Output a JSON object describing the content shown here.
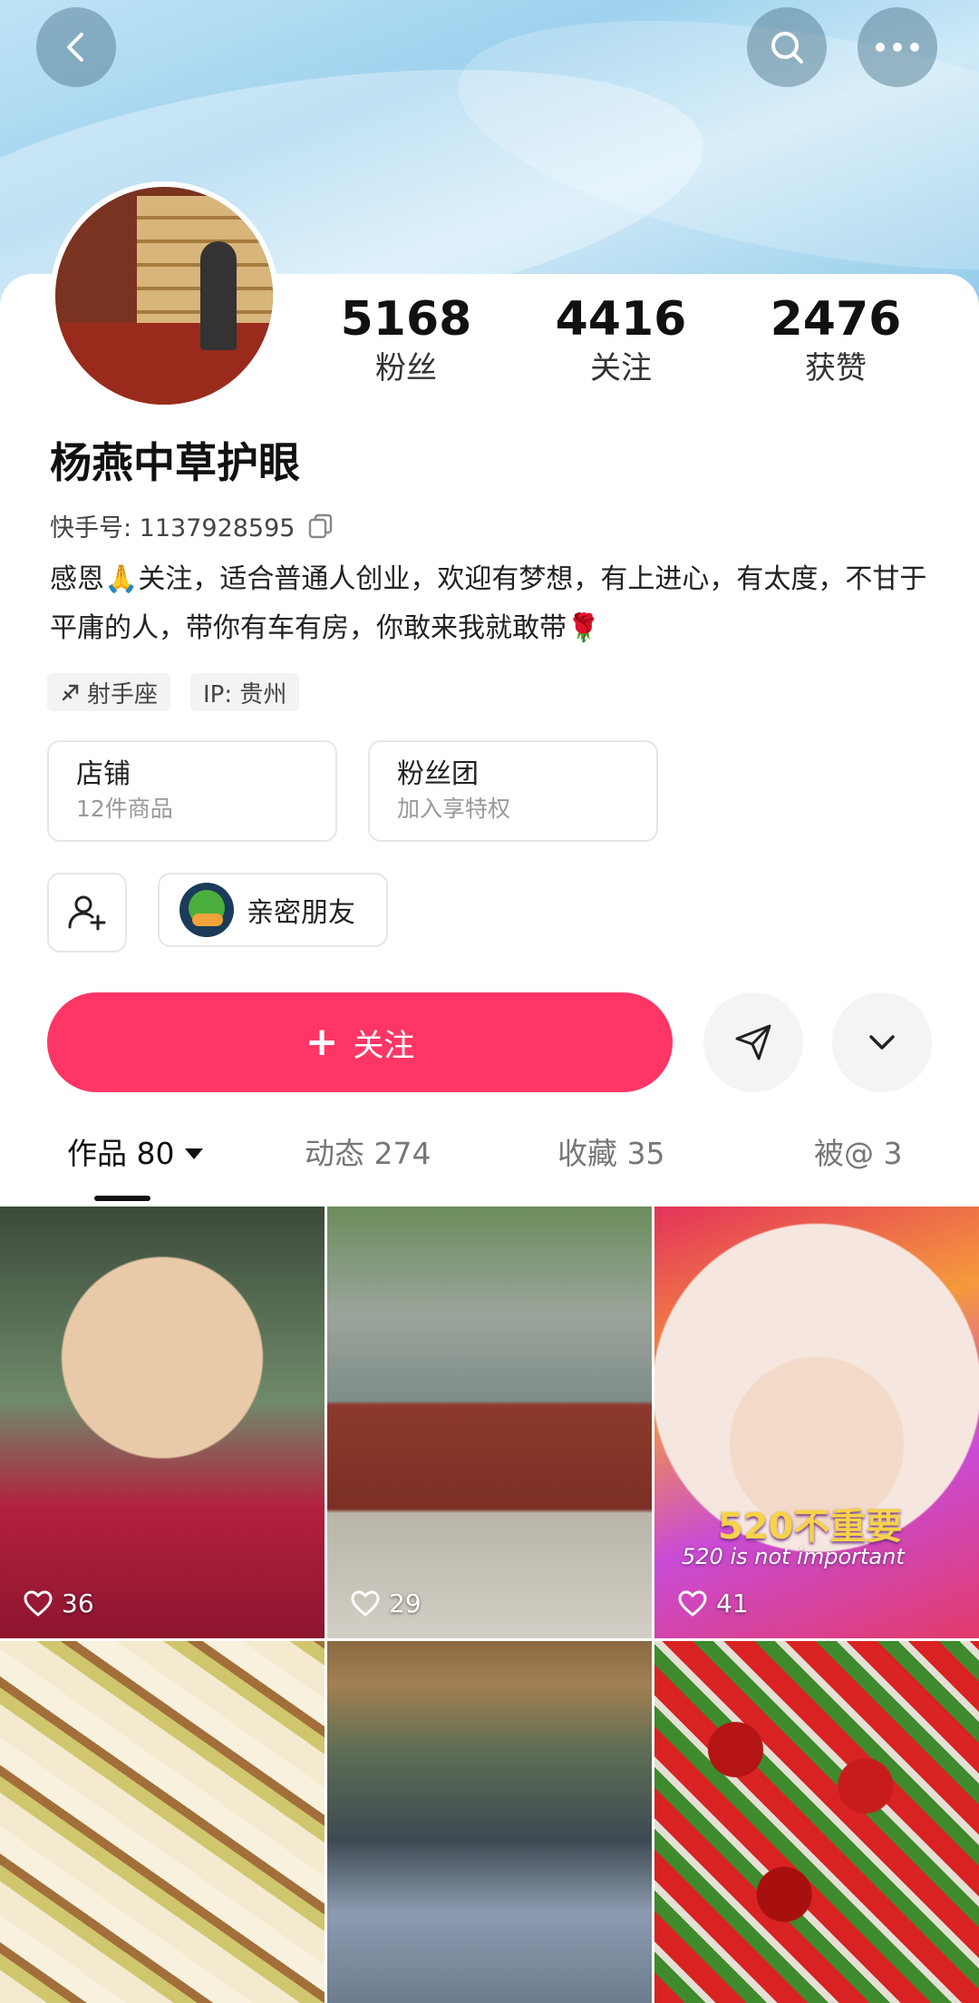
{
  "profile": {
    "name": "杨燕中草护眼",
    "kuaishou_id": "快手号: 1137928595",
    "bio": "感恩🙏关注，适合普通人创业，欢迎有梦想，有上进心，有太度，不甘于平庸的人，带你有车有房，你敢来我就敢带🌹"
  },
  "stats": [
    {
      "value": "5168",
      "label": "粉丝"
    },
    {
      "value": "4416",
      "label": "关注"
    },
    {
      "value": "2476",
      "label": "获赞"
    }
  ],
  "tags": [
    "射手座",
    "IP: 贵州"
  ],
  "cards": [
    {
      "title": "店铺",
      "subtitle": "12件商品"
    },
    {
      "title": "粉丝团",
      "subtitle": "加入享特权"
    }
  ],
  "intimate": {
    "label": "亲密朋友"
  },
  "actions": {
    "follow_label": "关注"
  },
  "tabs": [
    {
      "label": "作品 80"
    },
    {
      "label": "动态 274"
    },
    {
      "label": "收藏 35"
    },
    {
      "label": "被@ 3"
    }
  ],
  "videos": [
    {
      "likes": "36"
    },
    {
      "likes": "29"
    },
    {
      "likes": "41"
    },
    {
      "likes": ""
    },
    {
      "likes": ""
    },
    {
      "likes": ""
    }
  ],
  "thumb3_overlay": "520不重要",
  "thumb3_overlay_sub": "520 is not important",
  "icons": {
    "back": "back-icon",
    "search": "search-icon",
    "more": "more-icon",
    "copy": "copy-icon",
    "zodiac": "sagittarius-icon",
    "add_friend": "add-friend-icon",
    "share": "send-icon",
    "dropdown": "chevron-down-icon",
    "heart": "heart-icon"
  },
  "colors": {
    "accent": "#fe3666",
    "banner": "#9fd2ee"
  }
}
